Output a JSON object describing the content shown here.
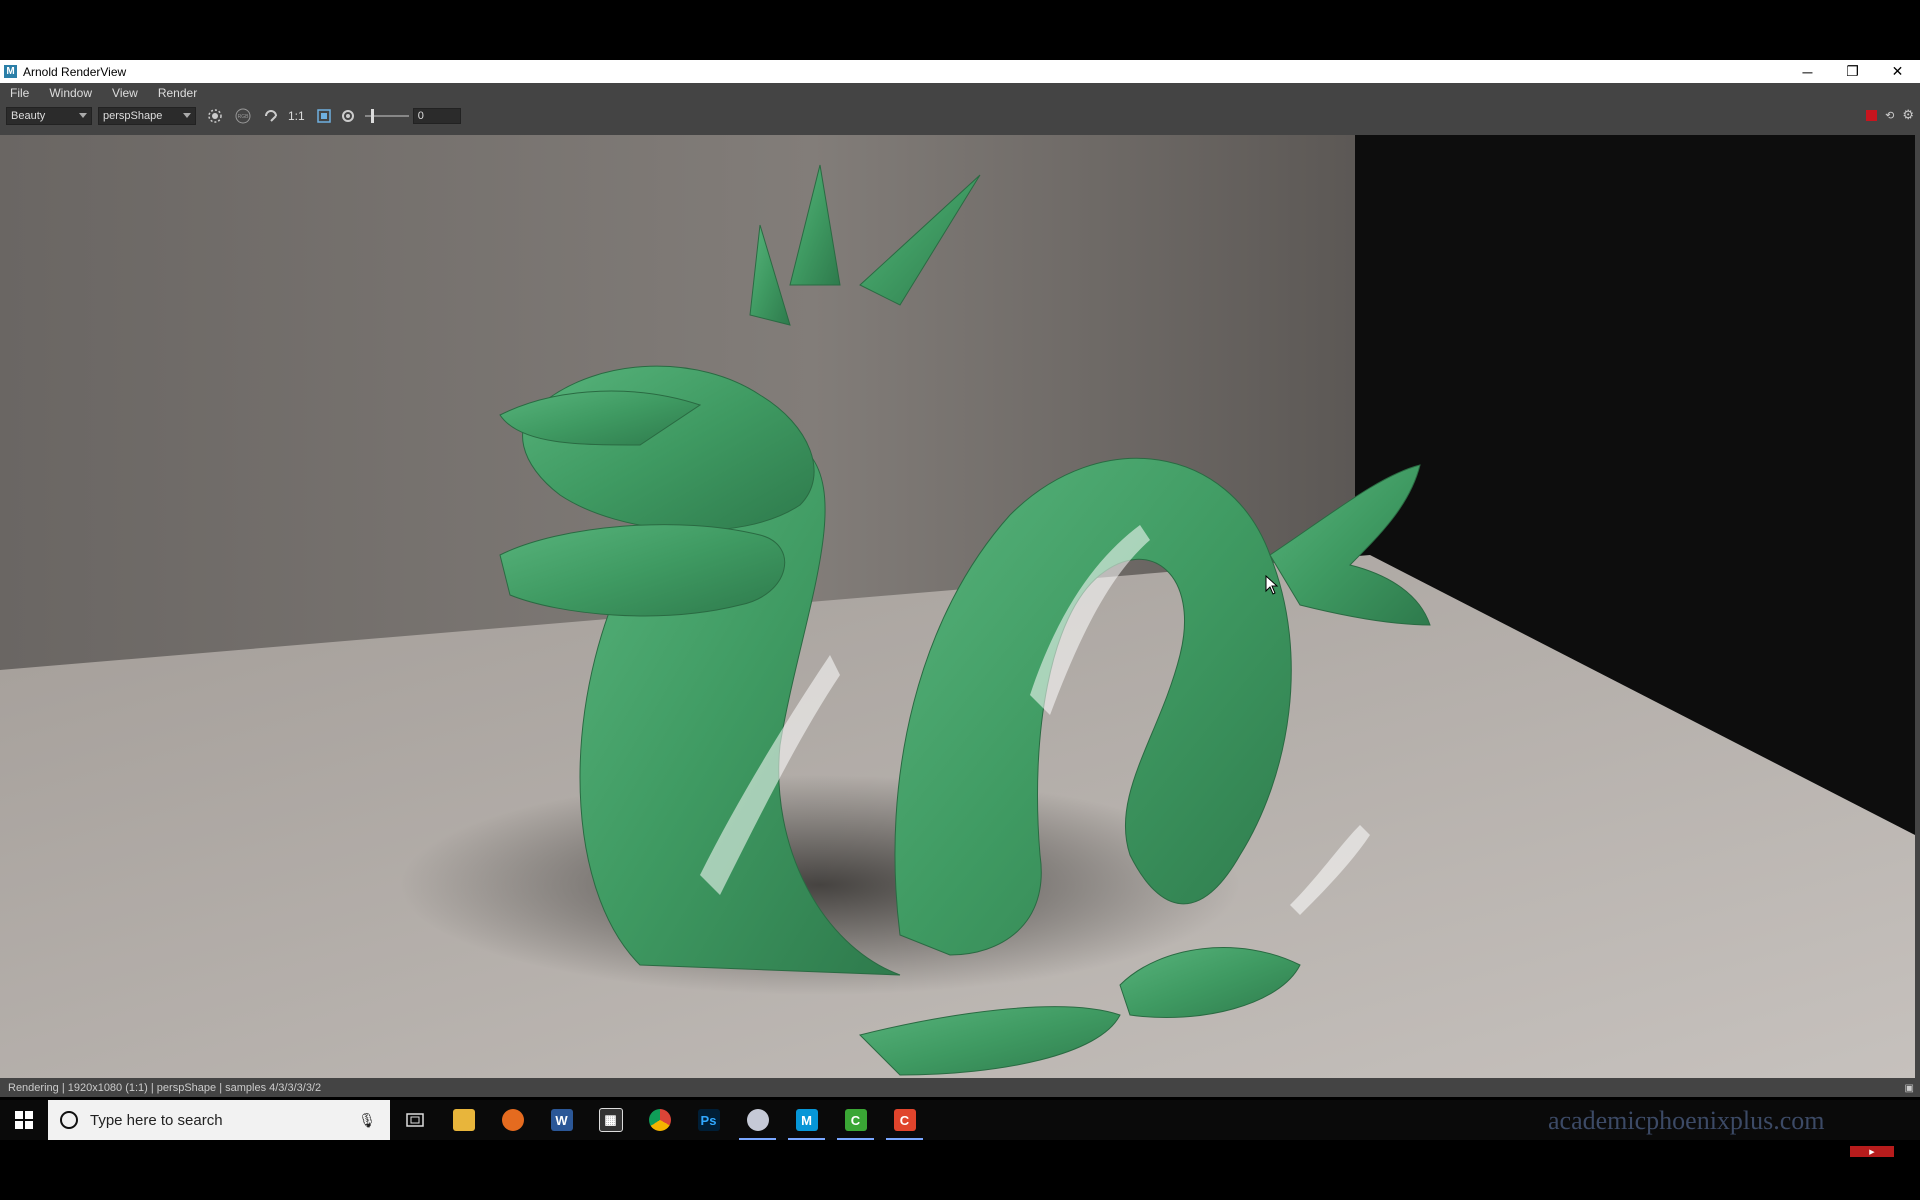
{
  "window": {
    "title": "Arnold RenderView",
    "app_icon_letter": "M",
    "controls": [
      "─",
      "❐",
      "✕"
    ]
  },
  "menubar": {
    "items": [
      "File",
      "Window",
      "View",
      "Render"
    ]
  },
  "toolbar": {
    "aov_value": "Beauty",
    "camera_value": "perspShape",
    "zoom_label": "1:1",
    "exposure_value": "0",
    "exposure_level": 0.15
  },
  "statusbar": {
    "text": "Rendering | 1920x1080 (1:1) | perspShape  | samples 4/3/3/3/3/2"
  },
  "taskbar": {
    "search_placeholder": "Type here to search",
    "apps": [
      "task-view",
      "file-explorer",
      "firefox",
      "word",
      "calculator",
      "chrome",
      "photoshop",
      "app-viewer",
      "maya",
      "camtasia-green",
      "camtasia-red"
    ]
  },
  "watermark": "academicphoenixplus.com",
  "colors": {
    "dragon": "#3f9a62",
    "stop_button": "#c8141e",
    "accent": "#7aa7ff"
  }
}
